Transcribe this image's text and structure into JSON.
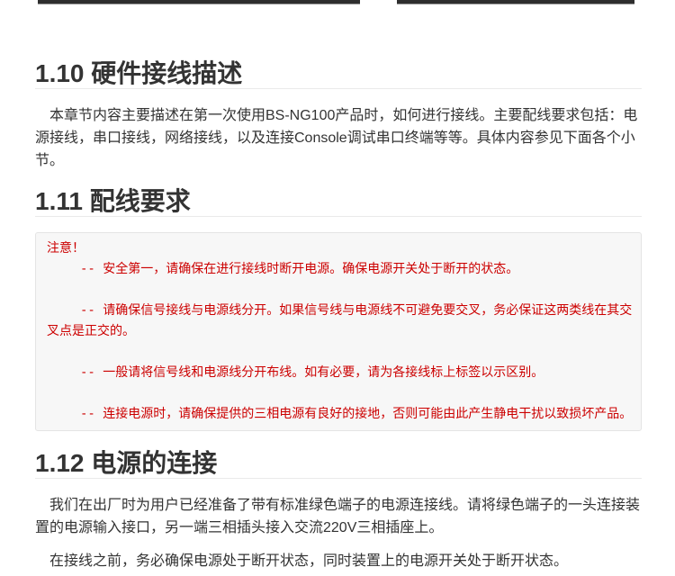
{
  "colors": {
    "text": "#333333",
    "heading": "#333333",
    "rule": "#eaeaea",
    "notice_text": "#cc0000",
    "notice_background": "#f7f7f7"
  },
  "sections": [
    {
      "heading": "1.10 硬件接线描述",
      "paragraphs": [
        "本章节内容主要描述在第一次使用BS-NG100产品时，如何进行接线。主要配线要求包括：电源接线，串口接线，网络接线，以及连接Console调试串口终端等等。具体内容参见下面各个小节。"
      ]
    },
    {
      "heading": "1.11 配线要求",
      "notice": {
        "title": "注意！",
        "items": [
          "-- 安全第一，请确保在进行接线时断开电源。确保电源开关处于断开的状态。",
          "-- 请确保信号接线与电源线分开。如果信号线与电源线不可避免要交叉，务必保证这两类线在其交叉点是正交的。",
          "-- 一般请将信号线和电源线分开布线。如有必要，请为各接线标上标签以示区别。",
          "-- 连接电源时，请确保提供的三相电源有良好的接地，否则可能由此产生静电干扰以致损坏产品。"
        ]
      }
    },
    {
      "heading": "1.12 电源的连接",
      "paragraphs": [
        "我们在出厂时为用户已经准备了带有标准绿色端子的电源连接线。请将绿色端子的一头连接装置的电源输入接口，另一端三相插头接入交流220V三相插座上。",
        "在接线之前，务必确保电源处于断开状态，同时装置上的电源开关处于断开状态。"
      ]
    }
  ]
}
